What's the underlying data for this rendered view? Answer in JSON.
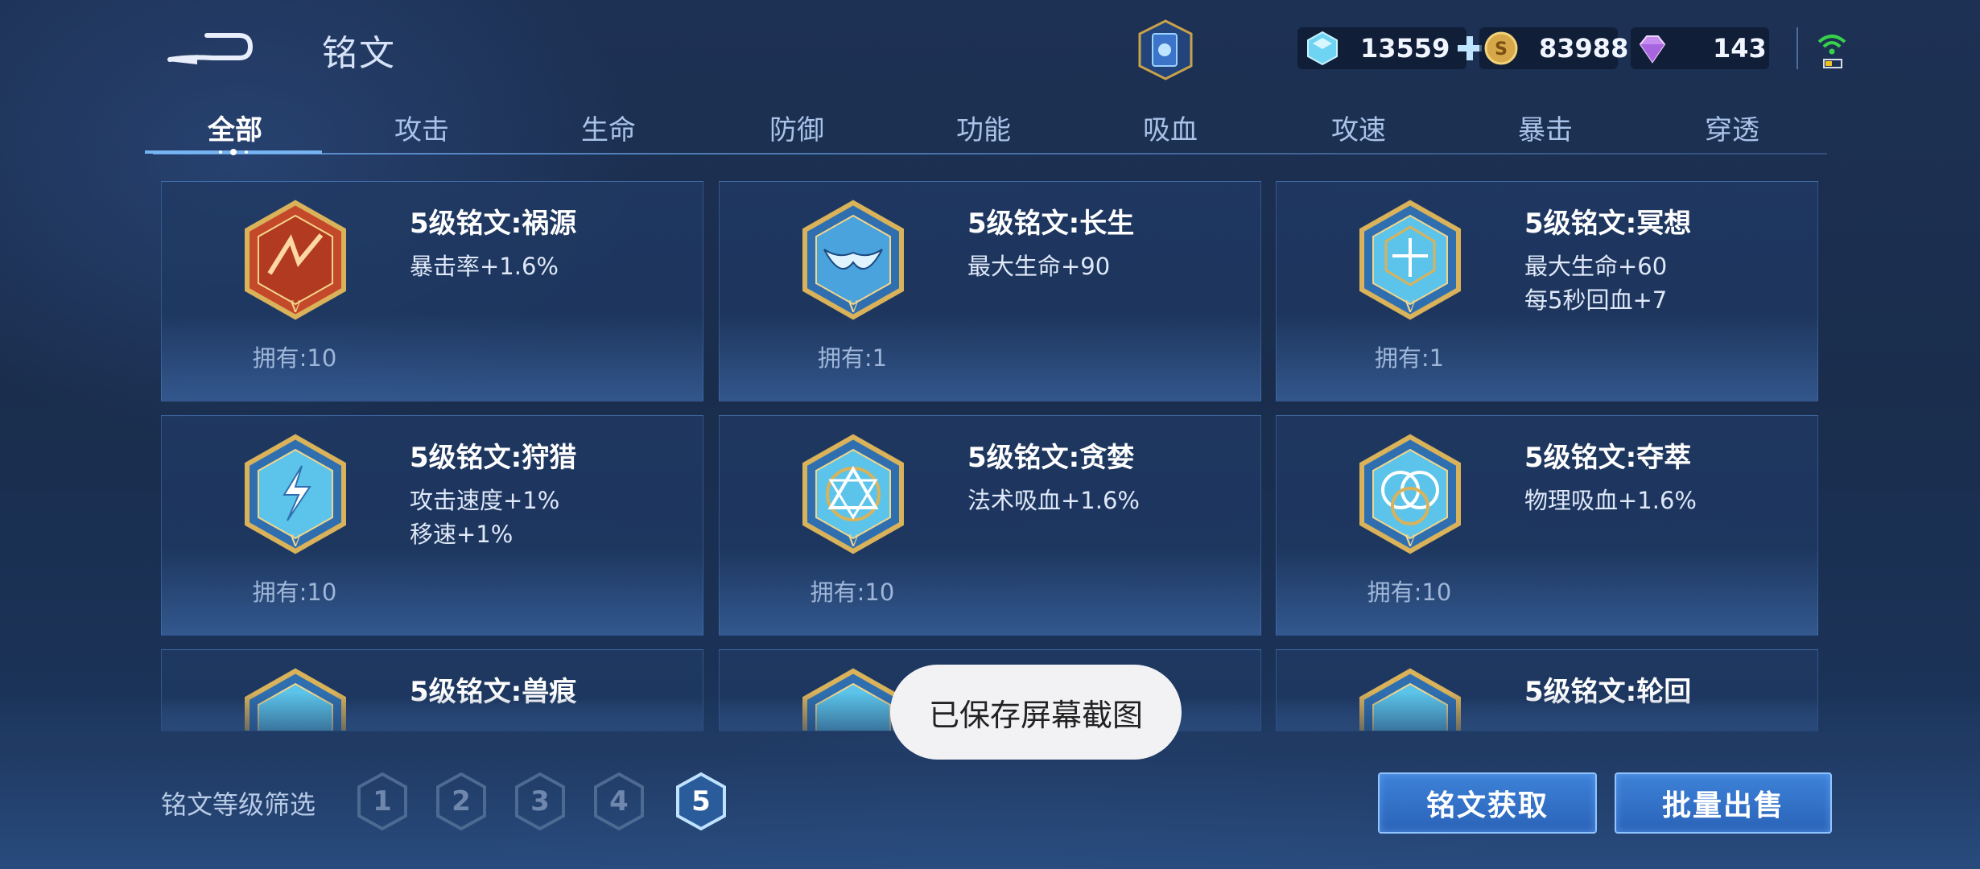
{
  "header": {
    "title": "铭文",
    "back_icon": "back-arrow-icon",
    "currencies": [
      {
        "icon": "diamond-icon",
        "value": "13559",
        "has_add": true
      },
      {
        "icon": "gold-coin-icon",
        "value": "83988"
      },
      {
        "icon": "gem-icon",
        "value": "143"
      }
    ]
  },
  "tabs": [
    "全部",
    "攻击",
    "生命",
    "防御",
    "功能",
    "吸血",
    "攻速",
    "暴击",
    "穿透"
  ],
  "active_tab": "全部",
  "cards": [
    {
      "name": "5级铭文:祸源",
      "stats": [
        "暴击率+1.6%"
      ],
      "owned": "拥有:10",
      "emblem_color": "#c0392b"
    },
    {
      "name": "5级铭文:长生",
      "stats": [
        "最大生命+90"
      ],
      "owned": "拥有:1",
      "emblem_color": "#3a7fc0"
    },
    {
      "name": "5级铭文:冥想",
      "stats": [
        "最大生命+60",
        "每5秒回血+7"
      ],
      "owned": "拥有:1",
      "emblem_color": "#3a7fc0"
    },
    {
      "name": "5级铭文:狩猎",
      "stats": [
        "攻击速度+1%",
        "移速+1%"
      ],
      "owned": "拥有:10",
      "emblem_color": "#3a7fc0"
    },
    {
      "name": "5级铭文:贪婪",
      "stats": [
        "法术吸血+1.6%"
      ],
      "owned": "拥有:10",
      "emblem_color": "#3a7fc0"
    },
    {
      "name": "5级铭文:夺萃",
      "stats": [
        "物理吸血+1.6%"
      ],
      "owned": "拥有:10",
      "emblem_color": "#3a7fc0"
    },
    {
      "name": "5级铭文:兽痕",
      "stats": [
        ""
      ],
      "owned": "",
      "emblem_color": "#3a7fc0"
    },
    {
      "name": "",
      "stats": [
        ""
      ],
      "owned": "",
      "emblem_color": "#3a7fc0"
    },
    {
      "name": "5级铭文:轮回",
      "stats": [
        ""
      ],
      "owned": "",
      "emblem_color": "#3a7fc0"
    }
  ],
  "filter": {
    "label": "铭文等级筛选",
    "levels": [
      "1",
      "2",
      "3",
      "4",
      "5"
    ],
    "active": "5"
  },
  "buttons": {
    "get": "铭文获取",
    "sell": "批量出售"
  },
  "toast": "已保存屏幕截图",
  "colors": {
    "accent_blue": "#2a63b8",
    "tab_active": "#ffffff",
    "tab_inactive": "#a9c2e8",
    "gold": "#d6a84a"
  }
}
